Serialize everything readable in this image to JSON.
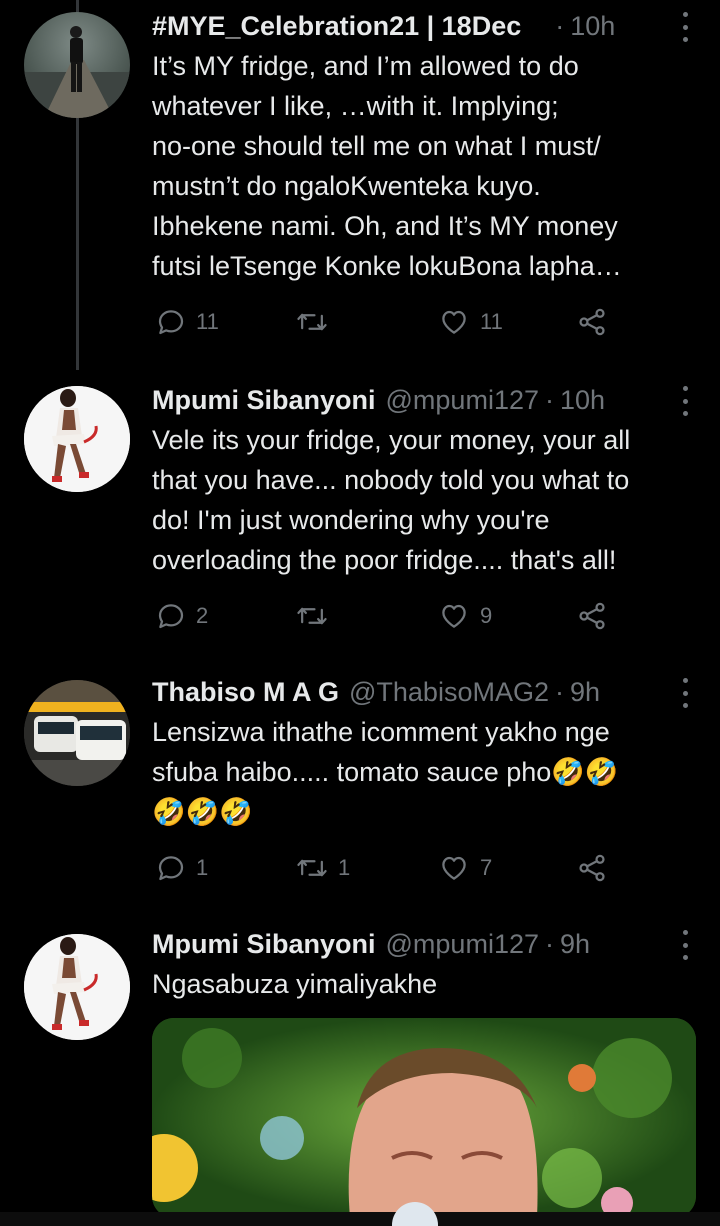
{
  "tweets": [
    {
      "name": "#MYE_Celebration21 | 18Dec",
      "handle": "",
      "time": "10h",
      "text": "It’s MY fridge, and I’m allowed to do\nwhatever I like, …with it. Implying;\nno-one should tell me on what I must/\nmustn’t do ngaloKwenteka kuyo.\nIbhekene nami. Oh, and It’s MY money\nfutsi leTsenge Konke lokuBona lapha…",
      "replies": "11",
      "retweets": "",
      "likes": "11"
    },
    {
      "name": "Mpumi Sibanyoni",
      "handle": "@mpumi127",
      "time": "10h",
      "text": "Vele its your fridge, your money, your all\nthat you have... nobody told you what to\ndo! I'm just wondering why you're\noverloading the poor fridge.... that's all!",
      "replies": "2",
      "retweets": "",
      "likes": "9"
    },
    {
      "name": "Thabiso M A G",
      "handle": "@ThabisoMAG2",
      "time": "9h",
      "text": "Lensizwa ithathe icomment yakho nge\nsfuba haibo..... tomato sauce pho🤣🤣\n🤣🤣🤣",
      "replies": "1",
      "retweets": "1",
      "likes": "7"
    },
    {
      "name": "Mpumi Sibanyoni",
      "handle": "@mpumi127",
      "time": "9h",
      "text": "Ngasabuza yimaliyakhe",
      "replies": "",
      "retweets": "",
      "likes": ""
    }
  ],
  "separator": "·",
  "icons": {
    "reply": "reply-icon",
    "retweet": "retweet-icon",
    "like": "heart-icon",
    "share": "share-icon",
    "more": "more-icon"
  },
  "colors": {
    "background": "#000000",
    "text": "#e7e9ea",
    "secondary": "#71767b",
    "thread_line": "#333639"
  }
}
